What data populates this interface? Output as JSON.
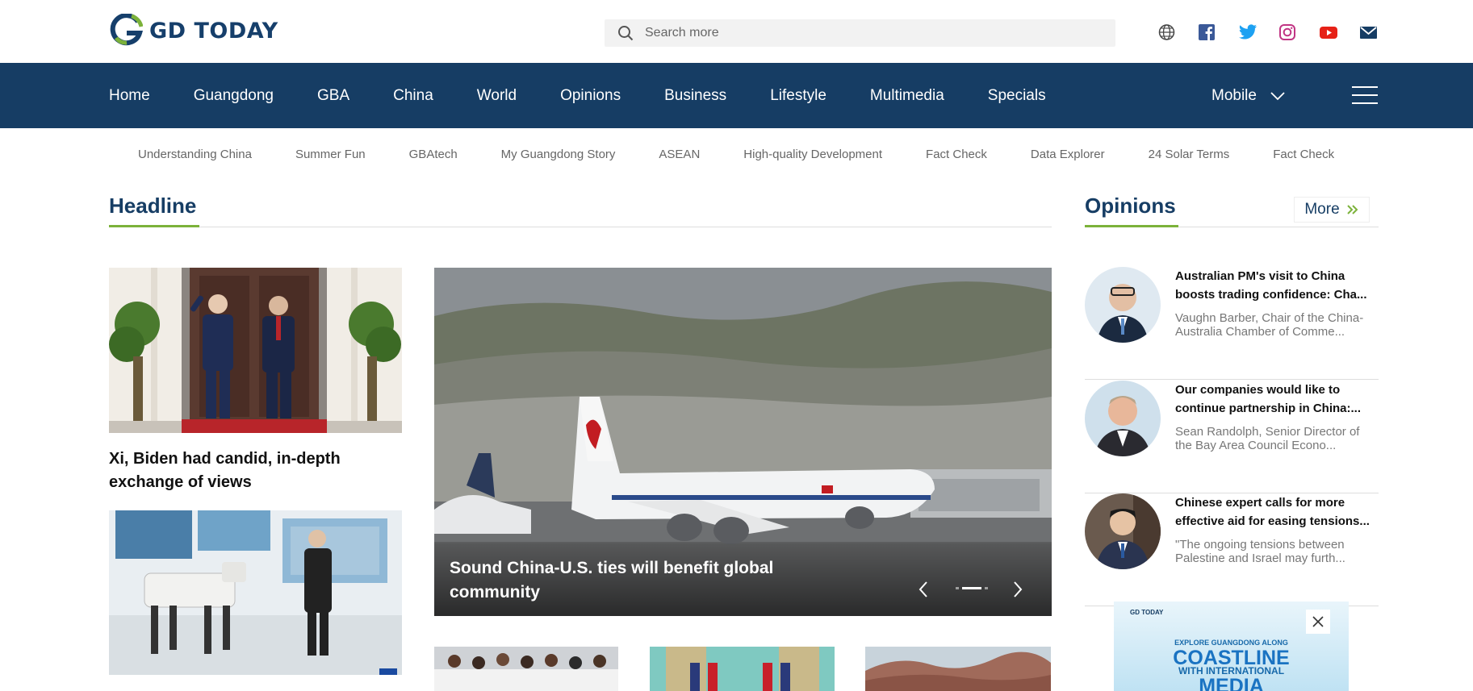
{
  "brand": {
    "name": "GD TODAY"
  },
  "search": {
    "placeholder": "Search more"
  },
  "social": [
    "globe-icon",
    "facebook-icon",
    "twitter-icon",
    "instagram-icon",
    "youtube-icon",
    "mail-icon"
  ],
  "nav": {
    "items": [
      "Home",
      "Guangdong",
      "GBA",
      "China",
      "World",
      "Opinions",
      "Business",
      "Lifestyle",
      "Multimedia",
      "Specials"
    ],
    "mobile": "Mobile"
  },
  "subnav": [
    "Understanding China",
    "Summer Fun",
    "GBAtech",
    "My Guangdong Story",
    "ASEAN",
    "High-quality Development",
    "Fact Check",
    "Data Explorer",
    "24 Solar Terms",
    "Fact Check"
  ],
  "headline": {
    "section_title": "Headline",
    "lead_story": "Xi, Biden had candid, in-depth exchange of views",
    "carousel_title": "Sound China-U.S. ties will benefit global community"
  },
  "opinions": {
    "section_title": "Opinions",
    "more_label": "More",
    "items": [
      {
        "title": "Australian PM's visit to China boosts trading confidence: Cha...",
        "desc": "Vaughn Barber, Chair of the China-Australia Chamber of Comme..."
      },
      {
        "title": "Our companies would like to continue partnership in China:...",
        "desc": "Sean Randolph, Senior Director of the Bay Area Council Econo..."
      },
      {
        "title": "Chinese expert calls for more effective aid for easing tensions...",
        "desc": "\"The ongoing tensions between Palestine and Israel may furth..."
      }
    ]
  },
  "ad": {
    "logo": "GD TODAY",
    "line1": "EXPLORE GUANGDONG ALONG",
    "line2": "COASTLINE",
    "line3": "WITH INTERNATIONAL",
    "line4": "MEDIA"
  },
  "colors": {
    "nav_bg": "#163d64",
    "accent": "#7cb23a",
    "title": "#163d64"
  }
}
